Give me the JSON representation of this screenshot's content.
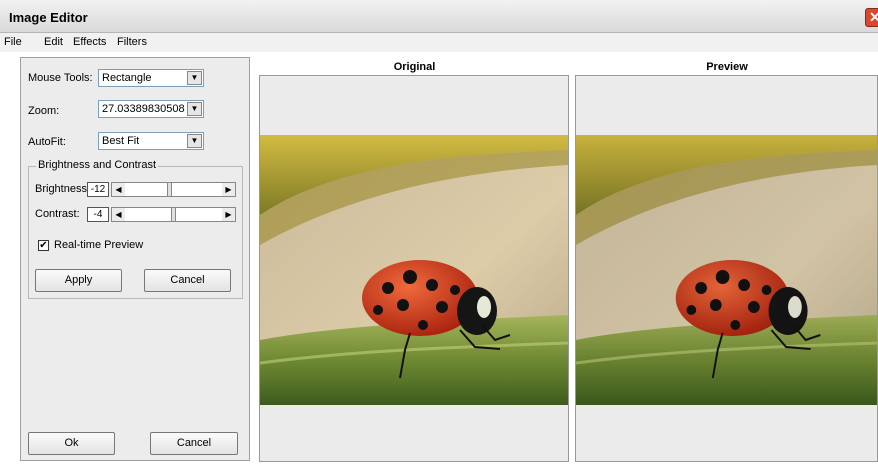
{
  "window": {
    "title": "Image Editor"
  },
  "menu": {
    "items": [
      "File",
      "Edit",
      "Effects",
      "Filters"
    ]
  },
  "left_panel": {
    "mouse_tools": {
      "label": "Mouse Tools:",
      "value": "Rectangle"
    },
    "zoom": {
      "label": "Zoom:",
      "value": "27.033898305084"
    },
    "autofit": {
      "label": "AutoFit:",
      "value": "Best Fit"
    },
    "brightness_contrast": {
      "title": "Brightness and Contrast",
      "brightness_label": "Brightness:",
      "brightness_value": "-12",
      "contrast_label": "Contrast:",
      "contrast_value": "-4",
      "realtime_label": "Real-time Preview",
      "realtime_checked": true,
      "apply_label": "Apply",
      "cancel_label": "Cancel"
    },
    "ok_label": "Ok",
    "cancel_label": "Cancel"
  },
  "panes": {
    "original_label": "Original",
    "preview_label": "Preview"
  }
}
